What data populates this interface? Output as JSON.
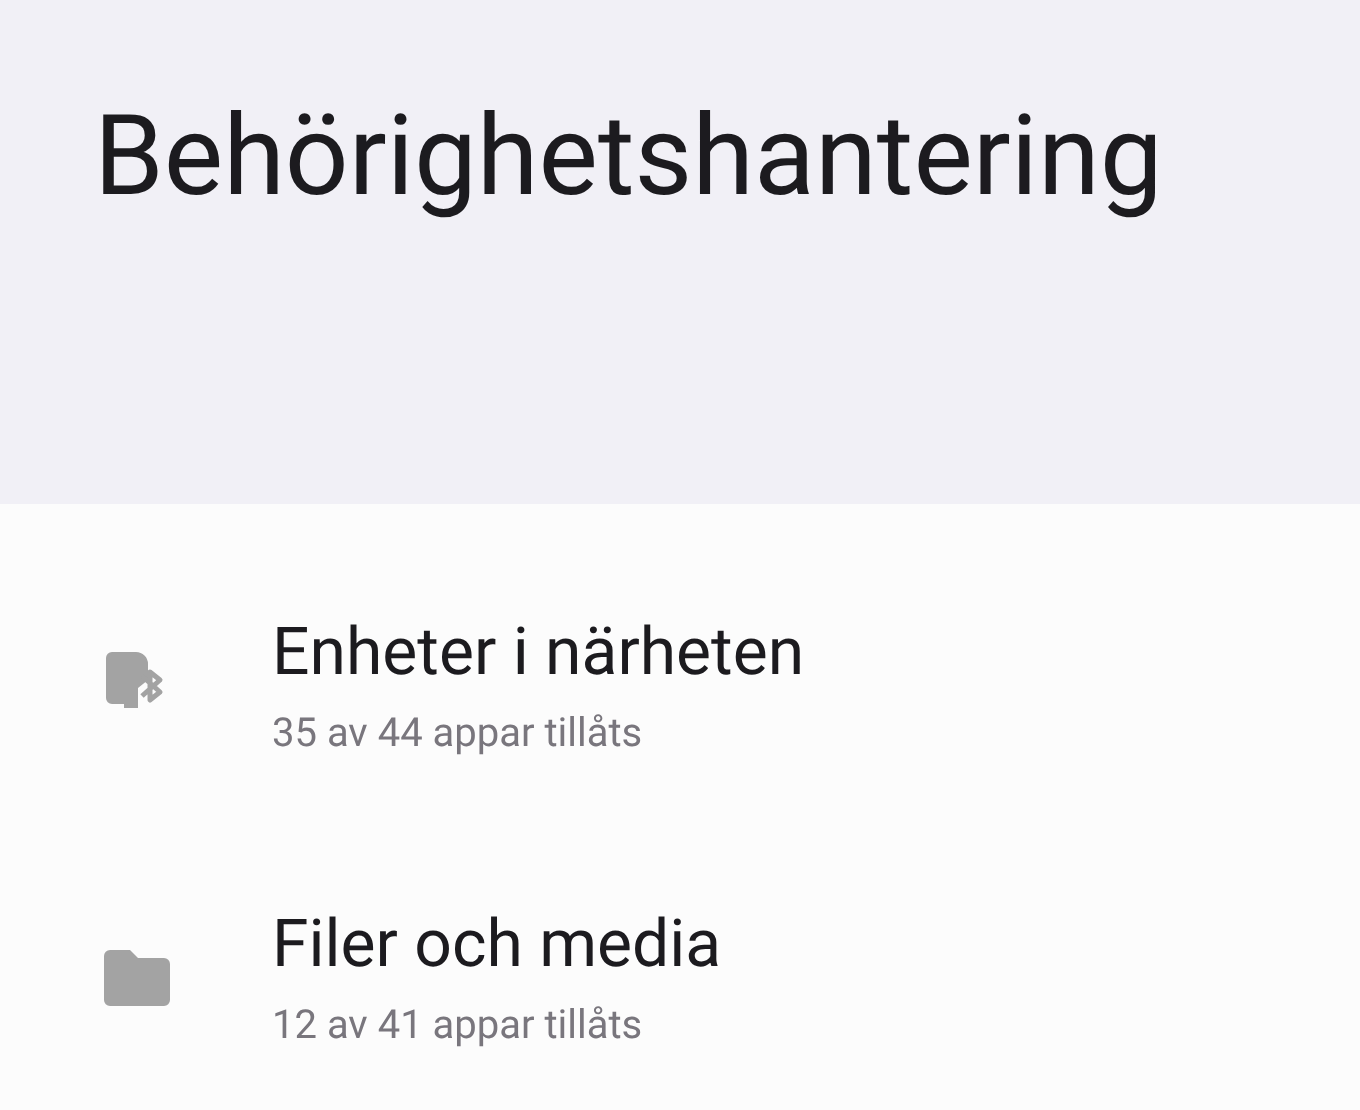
{
  "header": {
    "title": "Behörighetshantering"
  },
  "items": [
    {
      "kind": "nearby",
      "title": "Enheter i närheten",
      "summary": "35 av 44 appar tillåts"
    },
    {
      "kind": "files",
      "title": "Filer och media",
      "summary": "12 av 41 appar tillåts"
    }
  ]
}
